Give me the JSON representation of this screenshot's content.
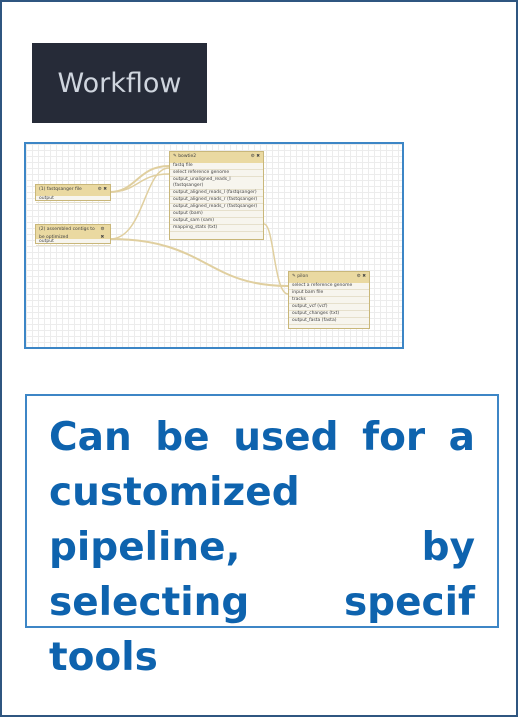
{
  "header": {
    "title": "Workflow"
  },
  "workflow": {
    "input_nodes": [
      {
        "title": "(1) fastqsanger file",
        "output": "output"
      },
      {
        "title": "(2) assembled contigs to be optimized",
        "output": "output"
      }
    ],
    "tool_nodes": [
      {
        "title": "bowtie2",
        "rows": [
          "fastq file",
          "select reference genome",
          "output_unaligned_reads_l (fastqsanger)",
          "output_aligned_reads_l (fastqsanger)",
          "output_aligned_reads_r (fastqsanger)",
          "output_aligned_reads_r (fastqsanger)",
          "output (bam)",
          "output_sam (sam)",
          "mapping_stats (txt)"
        ]
      },
      {
        "title": "pilon",
        "rows": [
          "select a reference genome",
          "input bam file",
          "tracks",
          "output_vcf (vcf)",
          "output_changes (txt)",
          "output_fasta (fasta)"
        ]
      }
    ]
  },
  "note": {
    "text": "Can be used for a customized pipeline, by selecting specif tools"
  },
  "colors": {
    "accent": "#0e63ae",
    "border": "#3d86c6",
    "header_bg": "#262b38"
  }
}
